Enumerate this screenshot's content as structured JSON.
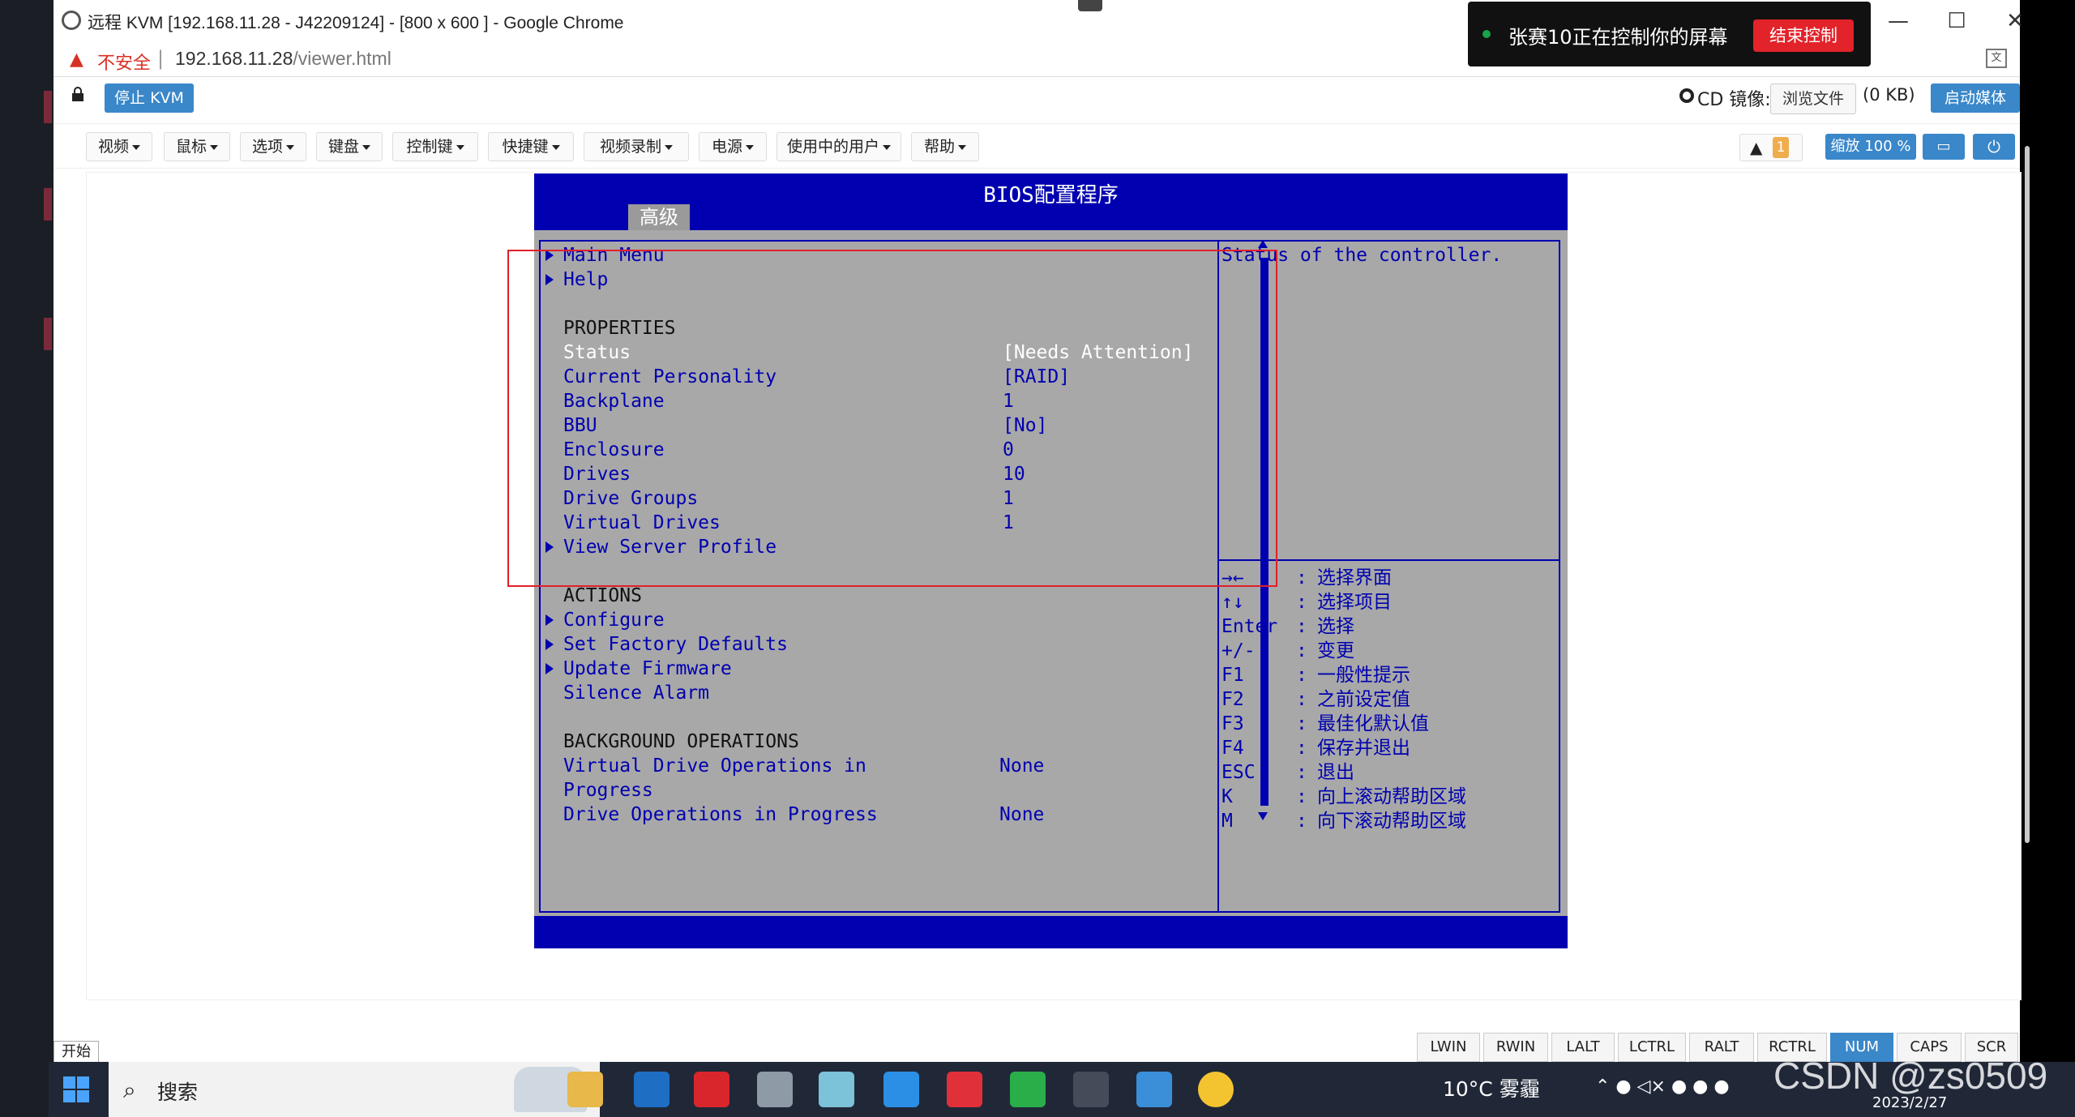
{
  "window": {
    "title": "远程 KVM [192.168.11.28 - J42209124] - [800 x 600 ] - Google Chrome",
    "minimize": "—",
    "maximize": "☐",
    "close": "✕"
  },
  "address": {
    "security": "不安全",
    "host": "192.168.11.28",
    "path": "/viewer.html"
  },
  "share_banner": {
    "text": "张赛10正在控制你的屏幕",
    "stop": "结束控制"
  },
  "kvm_toolbar": {
    "stop_kvm": "停止 KVM",
    "cd_label": "CD 镜像:",
    "browse": "浏览文件",
    "cd_size": "(0 KB)",
    "launch_media": "启动媒体",
    "menus": [
      "视频",
      "鼠标",
      "选项",
      "键盘",
      "控制键",
      "快捷键",
      "视频录制",
      "电源",
      "使用中的用户",
      "帮助"
    ],
    "alert_count": "1",
    "zoom": "缩放 100 %"
  },
  "bios": {
    "title": "BIOS配置程序",
    "tab": "高级",
    "nav": [
      "Main Menu",
      "Help"
    ],
    "properties_heading": "PROPERTIES",
    "properties": [
      {
        "label": "Status",
        "value": "[Needs Attention]"
      },
      {
        "label": "Current Personality",
        "value": "[RAID]"
      },
      {
        "label": "Backplane",
        "value": "1"
      },
      {
        "label": "BBU",
        "value": "[No]"
      },
      {
        "label": "Enclosure",
        "value": "0"
      },
      {
        "label": "Drives",
        "value": "10"
      },
      {
        "label": "Drive Groups",
        "value": "1"
      },
      {
        "label": "Virtual Drives",
        "value": "1"
      }
    ],
    "view_server_profile": "View Server Profile",
    "actions_heading": "ACTIONS",
    "actions": [
      "Configure",
      "Set Factory Defaults",
      "Update Firmware",
      "Silence Alarm"
    ],
    "background_heading": "BACKGROUND OPERATIONS",
    "bg_ops": [
      {
        "label": "Virtual Drive Operations in",
        "label2": "Progress",
        "value": "None"
      },
      {
        "label": "Drive Operations in Progress",
        "value": "None"
      }
    ],
    "help_text": "Status of the controller.",
    "keys": [
      {
        "key": "→←",
        "sep": ":",
        "desc": "选择界面"
      },
      {
        "key": "↑↓",
        "sep": ":",
        "desc": "选择项目"
      },
      {
        "key": "Enter",
        "sep": ":",
        "desc": "选择"
      },
      {
        "key": "+/-",
        "sep": ":",
        "desc": "变更"
      },
      {
        "key": "F1",
        "sep": ":",
        "desc": "一般性提示"
      },
      {
        "key": "F2",
        "sep": ":",
        "desc": "之前设定值"
      },
      {
        "key": "F3",
        "sep": ":",
        "desc": "最佳化默认值"
      },
      {
        "key": "F4",
        "sep": ":",
        "desc": "保存并退出"
      },
      {
        "key": "ESC",
        "sep": ":",
        "desc": "退出"
      },
      {
        "key": "K",
        "sep": ":",
        "desc": "向上滚动帮助区域"
      },
      {
        "key": "M",
        "sep": ":",
        "desc": "向下滚动帮助区域"
      }
    ]
  },
  "status_keys": [
    "LWIN",
    "RWIN",
    "LALT",
    "LCTRL",
    "RALT",
    "RCTRL",
    "NUM",
    "CAPS",
    "SCR"
  ],
  "start_label": "开始",
  "taskbar": {
    "search": "搜索",
    "weather": "10°C 雾霾",
    "date": "2023/2/27"
  },
  "watermark": "CSDN @zs0509",
  "colors": {
    "bios_blue": "#0000b0",
    "bios_gray": "#a8a8a8",
    "kvm_blue": "#3a87c9",
    "highlight_red": "#e0202a"
  }
}
